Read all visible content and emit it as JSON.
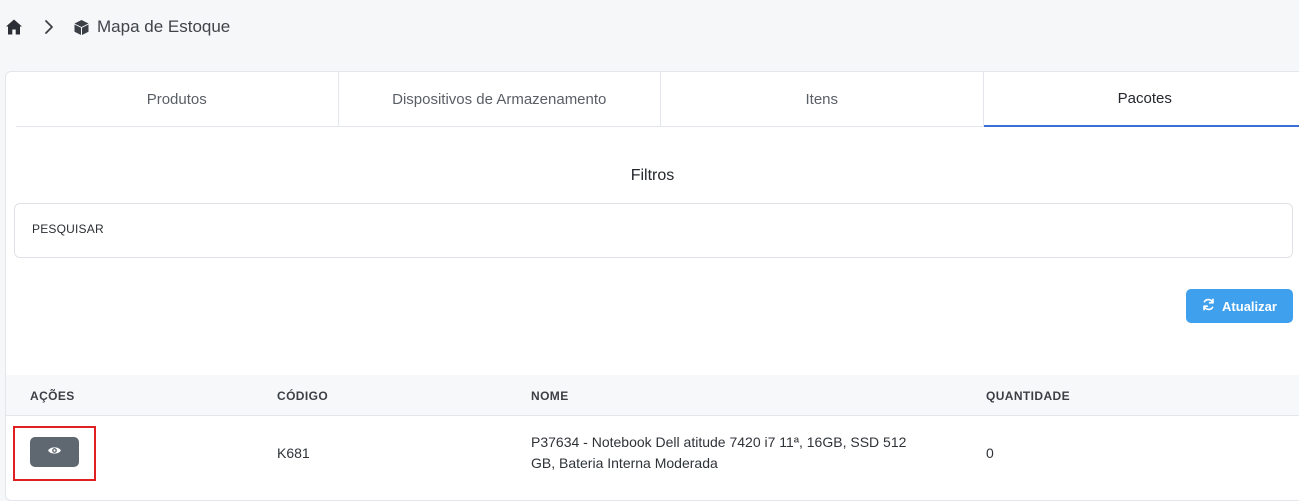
{
  "breadcrumb": {
    "home_icon": "home-icon",
    "separator_icon": "chevron-right-icon",
    "page_icon": "box-icon",
    "title": "Mapa de Estoque"
  },
  "tabs": [
    {
      "label": "Produtos",
      "active": false
    },
    {
      "label": "Dispositivos de Armazenamento",
      "active": false
    },
    {
      "label": "Itens",
      "active": false
    },
    {
      "label": "Pacotes",
      "active": true
    }
  ],
  "filters": {
    "title": "Filtros",
    "search_label": "PESQUISAR"
  },
  "actions": {
    "refresh_label": "Atualizar",
    "refresh_icon": "refresh-icon"
  },
  "table": {
    "headers": [
      "AÇÕES",
      "CÓDIGO",
      "NOME",
      "QUANTIDADE"
    ],
    "rows": [
      {
        "action_icon": "eye-icon",
        "codigo": "K681",
        "nome": "P37634 - Notebook Dell atitude 7420 i7 11ª, 16GB, SSD 512 GB, Bateria Interna Moderada",
        "quantidade": "0"
      }
    ]
  },
  "colors": {
    "accent": "#3b6fd8",
    "button_blue": "#3fa0ee",
    "view_button": "#5f6871",
    "highlight": "#e02020"
  }
}
